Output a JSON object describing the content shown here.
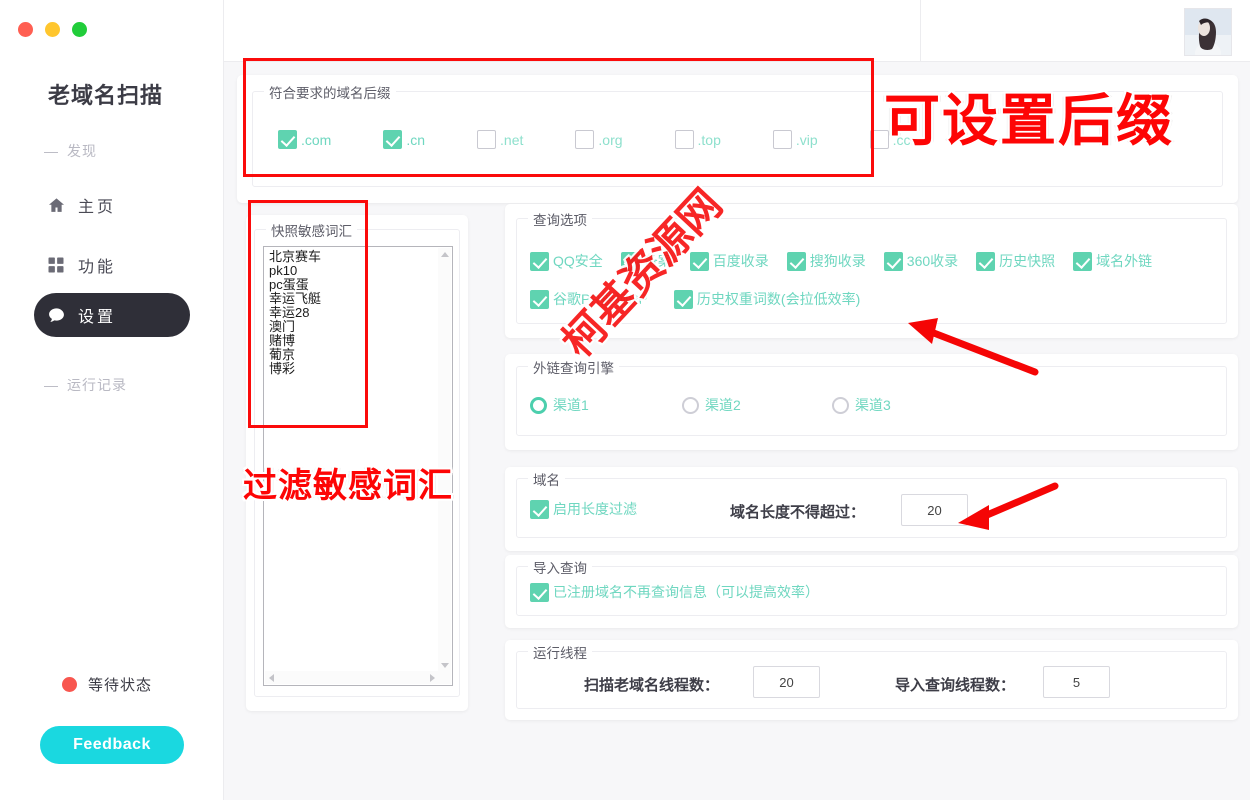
{
  "window": {
    "traffic_lights": [
      "close",
      "minimize",
      "maximize"
    ]
  },
  "sidebar": {
    "app_title": "老域名扫描",
    "groups": [
      {
        "label": "发现",
        "dash": "—"
      },
      {
        "label": "运行记录",
        "dash": "—"
      }
    ],
    "items": [
      {
        "label": "主页",
        "icon": "home-icon",
        "active": false
      },
      {
        "label": "功能",
        "icon": "grid-icon",
        "active": false
      },
      {
        "label": "设置",
        "icon": "chat-bubble-icon",
        "active": true
      }
    ],
    "status": {
      "text": "等待状态",
      "dot_color": "#f8564f"
    },
    "feedback_label": "Feedback",
    "feedback_color": "#1ad8e0"
  },
  "header": {
    "avatar_alt": "用户头像"
  },
  "suffix_section": {
    "legend": "符合要求的域名后缀",
    "options": [
      {
        "label": ".com",
        "checked": true
      },
      {
        "label": ".cn",
        "checked": true
      },
      {
        "label": ".net",
        "checked": false
      },
      {
        "label": ".org",
        "checked": false
      },
      {
        "label": ".top",
        "checked": false
      },
      {
        "label": ".vip",
        "checked": false
      },
      {
        "label": ".cc",
        "checked": false
      }
    ]
  },
  "sensitive_section": {
    "legend": "快照敏感词汇",
    "words": "北京赛车\npk10\npc蛋蛋\n幸运飞艇\n幸运28\n澳门\n赌博\n葡京\n博彩"
  },
  "query_section": {
    "legend": "查询选项",
    "row1": [
      {
        "label": "QQ安全",
        "checked": true
      },
      {
        "label": "备案",
        "checked": true
      },
      {
        "label": "百度收录",
        "checked": true
      },
      {
        "label": "搜狗收录",
        "checked": true
      },
      {
        "label": "360收录",
        "checked": true
      },
      {
        "label": "历史快照",
        "checked": true
      },
      {
        "label": "域名外链",
        "checked": true
      }
    ],
    "row2": [
      {
        "label": "谷歌PR搜狗RP",
        "checked": true
      },
      {
        "label": "历史权重词数(会拉低效率)",
        "checked": true
      }
    ]
  },
  "engine_section": {
    "legend": "外链查询引擎",
    "options": [
      {
        "label": "渠道1",
        "selected": true
      },
      {
        "label": "渠道2",
        "selected": false
      },
      {
        "label": "渠道3",
        "selected": false
      }
    ]
  },
  "domain_section": {
    "legend": "域名",
    "enable_filter": {
      "label": "启用长度过滤",
      "checked": true
    },
    "length_label": "域名长度不得超过：",
    "length_value": "20"
  },
  "import_section": {
    "legend": "导入查询",
    "option": {
      "label": "已注册域名不再查询信息（可以提高效率）",
      "checked": true
    }
  },
  "threads_section": {
    "legend": "运行线程",
    "scan_label": "扫描老域名线程数：",
    "scan_value": "20",
    "import_label": "导入查询线程数：",
    "import_value": "5"
  },
  "annotations": {
    "suffix_note": "可设置后缀",
    "sensitive_note": "过滤敏感词汇",
    "watermark": "柯基资源网",
    "highlight_color": "#fb0b0b"
  }
}
